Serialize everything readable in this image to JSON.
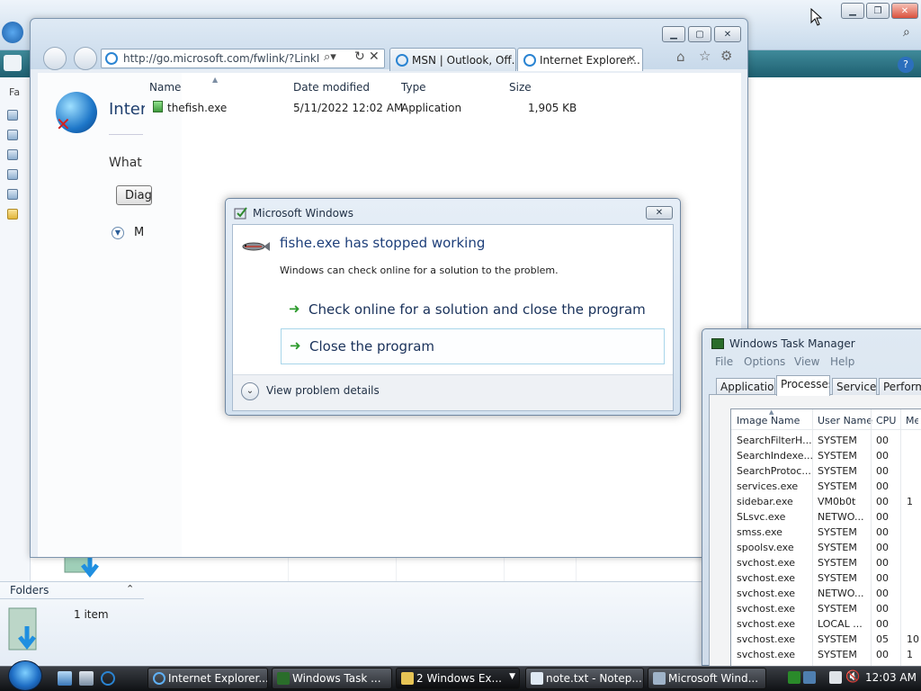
{
  "explorer_bg": {
    "folders_label": "Folders",
    "item_count": "1 item",
    "sidebar_first_letter": "Fa"
  },
  "ie_window": {
    "address": "http://go.microsoft.com/fwlink/?LinkID=",
    "tabs": [
      {
        "label": "MSN | Outlook, Off..."
      },
      {
        "label": "Internet Explorer..."
      }
    ],
    "page_title": "Interi",
    "page_question": "What y",
    "page_button": "Diag",
    "page_more": "M"
  },
  "file_list": {
    "columns": [
      "Name",
      "Date modified",
      "Type",
      "Size"
    ],
    "rows": [
      {
        "name": "thefish.exe",
        "date": "5/11/2022 12:02 AM",
        "type": "Application",
        "size": "1,905 KB"
      }
    ]
  },
  "dialog": {
    "title": "Microsoft Windows",
    "headline": "fishe.exe has stopped working",
    "subtext": "Windows can check online for a solution to the problem.",
    "option_check": "Check online for a solution and close the program",
    "option_close": "Close the program",
    "details": "View problem details"
  },
  "taskmgr": {
    "title": "Windows Task Manager",
    "menu": [
      "File",
      "Options",
      "View",
      "Help"
    ],
    "tabs": [
      "Applications",
      "Processes",
      "Services",
      "Performa"
    ],
    "columns": [
      "Image Name",
      "User Name",
      "CPU",
      "Mer"
    ],
    "rows": [
      {
        "image": "SearchFilterH...",
        "user": "SYSTEM",
        "cpu": "00",
        "mem": ""
      },
      {
        "image": "SearchIndexe...",
        "user": "SYSTEM",
        "cpu": "00",
        "mem": ""
      },
      {
        "image": "SearchProtoc...",
        "user": "SYSTEM",
        "cpu": "00",
        "mem": ""
      },
      {
        "image": "services.exe",
        "user": "SYSTEM",
        "cpu": "00",
        "mem": ""
      },
      {
        "image": "sidebar.exe",
        "user": "VM0b0t",
        "cpu": "00",
        "mem": "1"
      },
      {
        "image": "SLsvc.exe",
        "user": "NETWO...",
        "cpu": "00",
        "mem": ""
      },
      {
        "image": "smss.exe",
        "user": "SYSTEM",
        "cpu": "00",
        "mem": ""
      },
      {
        "image": "spoolsv.exe",
        "user": "SYSTEM",
        "cpu": "00",
        "mem": ""
      },
      {
        "image": "svchost.exe",
        "user": "SYSTEM",
        "cpu": "00",
        "mem": ""
      },
      {
        "image": "svchost.exe",
        "user": "SYSTEM",
        "cpu": "00",
        "mem": ""
      },
      {
        "image": "svchost.exe",
        "user": "NETWO...",
        "cpu": "00",
        "mem": ""
      },
      {
        "image": "svchost.exe",
        "user": "SYSTEM",
        "cpu": "00",
        "mem": ""
      },
      {
        "image": "svchost.exe",
        "user": "LOCAL ...",
        "cpu": "00",
        "mem": ""
      },
      {
        "image": "svchost.exe",
        "user": "SYSTEM",
        "cpu": "05",
        "mem": "10"
      },
      {
        "image": "svchost.exe",
        "user": "SYSTEM",
        "cpu": "00",
        "mem": "1"
      }
    ]
  },
  "taskbar": {
    "tasks": [
      {
        "label": "Internet Explorer...",
        "icon": "ie-icon"
      },
      {
        "label": "Windows Task ...",
        "icon": "taskmgr-icon"
      },
      {
        "label": "2 Windows Ex...",
        "icon": "folder-icon"
      },
      {
        "label": "note.txt - Notep...",
        "icon": "notepad-icon"
      },
      {
        "label": "Microsoft Wind...",
        "icon": "error-report-icon"
      }
    ],
    "clock": "12:03 AM"
  },
  "colors": {
    "accent_blue": "#1e3f7a",
    "toolbar_teal": "#1e5f70",
    "arrow_green": "#2e9b2e"
  }
}
